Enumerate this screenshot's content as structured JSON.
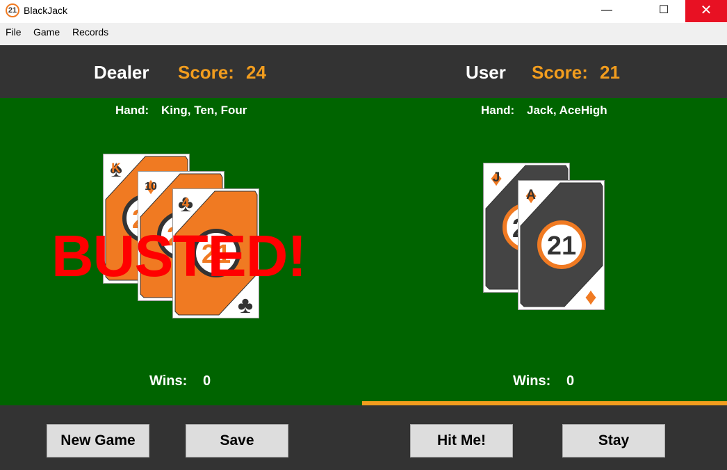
{
  "window": {
    "title": "BlackJack",
    "icon_text": "21",
    "minimize_icon": "—",
    "maximize_icon": "☐",
    "close_icon": "✕"
  },
  "menu": [
    "File",
    "Game",
    "Records"
  ],
  "dealer": {
    "name": "Dealer",
    "score_label": "Score:",
    "score": "24",
    "hand_label": "Hand:",
    "hand": "King, Ten, Four",
    "wins_label": "Wins:",
    "wins": "0",
    "cards": [
      {
        "rank": "K",
        "suit": "spades",
        "suit_glyph": "♠",
        "style": "orange"
      },
      {
        "rank": "10",
        "suit": "diamonds",
        "suit_glyph": "♦",
        "style": "orange"
      },
      {
        "rank": "4",
        "suit": "clubs",
        "suit_glyph": "♣",
        "style": "orange"
      }
    ],
    "status": "BUSTED!"
  },
  "user": {
    "name": "User",
    "score_label": "Score:",
    "score": "21",
    "hand_label": "Hand:",
    "hand": "Jack, AceHigh",
    "wins_label": "Wins:",
    "wins": "0",
    "cards": [
      {
        "rank": "J",
        "suit": "diamonds",
        "suit_glyph": "♦",
        "style": "dark"
      },
      {
        "rank": "A",
        "suit": "diamonds",
        "suit_glyph": "♦",
        "style": "dark"
      }
    ],
    "active_turn": true
  },
  "card_back_logo": "21",
  "buttons": {
    "new_game": "New Game",
    "save": "Save",
    "hit_me": "Hit Me!",
    "stay": "Stay"
  },
  "colors": {
    "felt": "#006400",
    "panel": "#333333",
    "accent": "#f29d1e",
    "card_orange": "#f07a22",
    "card_dark": "#444444",
    "busted": "#ff0000"
  }
}
